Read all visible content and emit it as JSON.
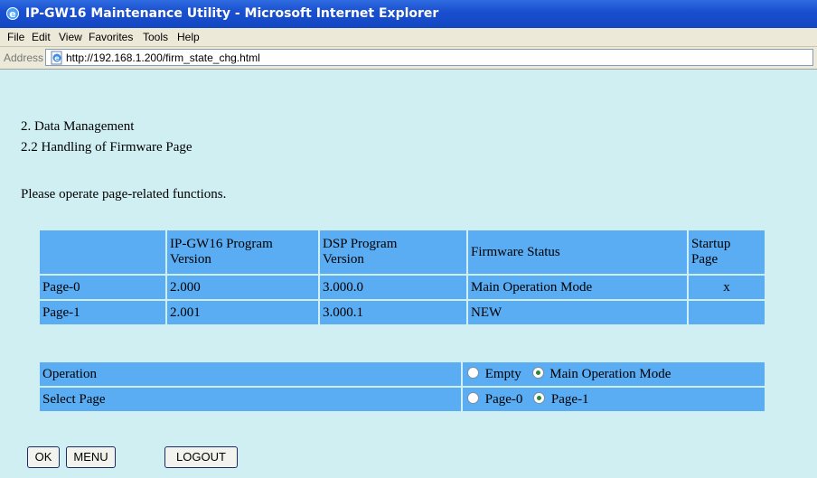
{
  "window": {
    "title": "IP-GW16 Maintenance Utility - Microsoft Internet Explorer"
  },
  "menu": [
    "File",
    "Edit",
    "View",
    "Favorites",
    "Tools",
    "Help"
  ],
  "address": {
    "label": "Address",
    "url": "http://192.168.1.200/firm_state_chg.html"
  },
  "page": {
    "heading1": "2. Data Management",
    "heading2": "2.2 Handling of Firmware Page",
    "instruction": "Please operate page-related functions."
  },
  "firmware_table": {
    "headers": {
      "program_line1": "IP-GW16 Program",
      "program_line2": "Version",
      "dsp_line1": "DSP Program",
      "dsp_line2": "Version",
      "status": "Firmware Status",
      "startup_line1": "Startup",
      "startup_line2": "Page"
    },
    "rows": [
      {
        "page": "Page-0",
        "program": "2.000",
        "dsp": "3.000.0",
        "status": "Main Operation Mode",
        "startup": "x"
      },
      {
        "page": "Page-1",
        "program": "2.001",
        "dsp": "3.000.1",
        "status": "NEW",
        "startup": ""
      }
    ]
  },
  "operation": {
    "label": "Operation",
    "options": [
      {
        "label": "Empty",
        "selected": false
      },
      {
        "label": "Main Operation Mode",
        "selected": true
      }
    ]
  },
  "select_page": {
    "label": "Select Page",
    "options": [
      {
        "label": "Page-0",
        "selected": false
      },
      {
        "label": "Page-1",
        "selected": true
      }
    ]
  },
  "buttons": {
    "ok": "OK",
    "menu": "MENU",
    "logout": "LOGOUT"
  },
  "colors": {
    "titlebar": "#1a50d0",
    "content_bg": "#cfeff3",
    "cell_bg": "#5aacf3",
    "radio_dot": "#2b8a2b"
  }
}
